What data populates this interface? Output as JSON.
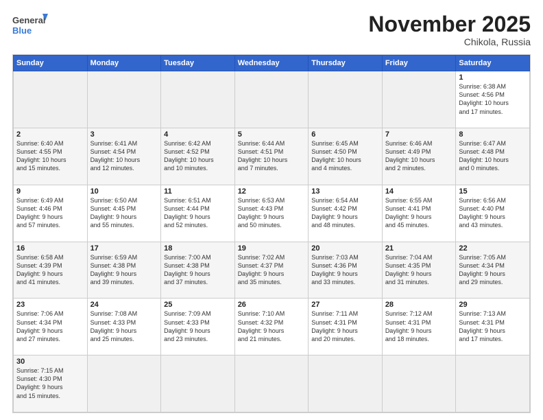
{
  "header": {
    "logo_general": "General",
    "logo_blue": "Blue",
    "month_title": "November 2025",
    "subtitle": "Chikola, Russia"
  },
  "weekdays": [
    "Sunday",
    "Monday",
    "Tuesday",
    "Wednesday",
    "Thursday",
    "Friday",
    "Saturday"
  ],
  "weeks": [
    [
      {
        "day": "",
        "info": "",
        "empty": true
      },
      {
        "day": "",
        "info": "",
        "empty": true
      },
      {
        "day": "",
        "info": "",
        "empty": true
      },
      {
        "day": "",
        "info": "",
        "empty": true
      },
      {
        "day": "",
        "info": "",
        "empty": true
      },
      {
        "day": "",
        "info": "",
        "empty": true
      },
      {
        "day": "1",
        "info": "Sunrise: 6:38 AM\nSunset: 4:56 PM\nDaylight: 10 hours\nand 17 minutes.",
        "empty": false
      }
    ],
    [
      {
        "day": "2",
        "info": "Sunrise: 6:40 AM\nSunset: 4:55 PM\nDaylight: 10 hours\nand 15 minutes.",
        "empty": false
      },
      {
        "day": "3",
        "info": "Sunrise: 6:41 AM\nSunset: 4:54 PM\nDaylight: 10 hours\nand 12 minutes.",
        "empty": false
      },
      {
        "day": "4",
        "info": "Sunrise: 6:42 AM\nSunset: 4:52 PM\nDaylight: 10 hours\nand 10 minutes.",
        "empty": false
      },
      {
        "day": "5",
        "info": "Sunrise: 6:44 AM\nSunset: 4:51 PM\nDaylight: 10 hours\nand 7 minutes.",
        "empty": false
      },
      {
        "day": "6",
        "info": "Sunrise: 6:45 AM\nSunset: 4:50 PM\nDaylight: 10 hours\nand 4 minutes.",
        "empty": false
      },
      {
        "day": "7",
        "info": "Sunrise: 6:46 AM\nSunset: 4:49 PM\nDaylight: 10 hours\nand 2 minutes.",
        "empty": false
      },
      {
        "day": "8",
        "info": "Sunrise: 6:47 AM\nSunset: 4:48 PM\nDaylight: 10 hours\nand 0 minutes.",
        "empty": false
      }
    ],
    [
      {
        "day": "9",
        "info": "Sunrise: 6:49 AM\nSunset: 4:46 PM\nDaylight: 9 hours\nand 57 minutes.",
        "empty": false
      },
      {
        "day": "10",
        "info": "Sunrise: 6:50 AM\nSunset: 4:45 PM\nDaylight: 9 hours\nand 55 minutes.",
        "empty": false
      },
      {
        "day": "11",
        "info": "Sunrise: 6:51 AM\nSunset: 4:44 PM\nDaylight: 9 hours\nand 52 minutes.",
        "empty": false
      },
      {
        "day": "12",
        "info": "Sunrise: 6:53 AM\nSunset: 4:43 PM\nDaylight: 9 hours\nand 50 minutes.",
        "empty": false
      },
      {
        "day": "13",
        "info": "Sunrise: 6:54 AM\nSunset: 4:42 PM\nDaylight: 9 hours\nand 48 minutes.",
        "empty": false
      },
      {
        "day": "14",
        "info": "Sunrise: 6:55 AM\nSunset: 4:41 PM\nDaylight: 9 hours\nand 45 minutes.",
        "empty": false
      },
      {
        "day": "15",
        "info": "Sunrise: 6:56 AM\nSunset: 4:40 PM\nDaylight: 9 hours\nand 43 minutes.",
        "empty": false
      }
    ],
    [
      {
        "day": "16",
        "info": "Sunrise: 6:58 AM\nSunset: 4:39 PM\nDaylight: 9 hours\nand 41 minutes.",
        "empty": false
      },
      {
        "day": "17",
        "info": "Sunrise: 6:59 AM\nSunset: 4:38 PM\nDaylight: 9 hours\nand 39 minutes.",
        "empty": false
      },
      {
        "day": "18",
        "info": "Sunrise: 7:00 AM\nSunset: 4:38 PM\nDaylight: 9 hours\nand 37 minutes.",
        "empty": false
      },
      {
        "day": "19",
        "info": "Sunrise: 7:02 AM\nSunset: 4:37 PM\nDaylight: 9 hours\nand 35 minutes.",
        "empty": false
      },
      {
        "day": "20",
        "info": "Sunrise: 7:03 AM\nSunset: 4:36 PM\nDaylight: 9 hours\nand 33 minutes.",
        "empty": false
      },
      {
        "day": "21",
        "info": "Sunrise: 7:04 AM\nSunset: 4:35 PM\nDaylight: 9 hours\nand 31 minutes.",
        "empty": false
      },
      {
        "day": "22",
        "info": "Sunrise: 7:05 AM\nSunset: 4:34 PM\nDaylight: 9 hours\nand 29 minutes.",
        "empty": false
      }
    ],
    [
      {
        "day": "23",
        "info": "Sunrise: 7:06 AM\nSunset: 4:34 PM\nDaylight: 9 hours\nand 27 minutes.",
        "empty": false
      },
      {
        "day": "24",
        "info": "Sunrise: 7:08 AM\nSunset: 4:33 PM\nDaylight: 9 hours\nand 25 minutes.",
        "empty": false
      },
      {
        "day": "25",
        "info": "Sunrise: 7:09 AM\nSunset: 4:33 PM\nDaylight: 9 hours\nand 23 minutes.",
        "empty": false
      },
      {
        "day": "26",
        "info": "Sunrise: 7:10 AM\nSunset: 4:32 PM\nDaylight: 9 hours\nand 21 minutes.",
        "empty": false
      },
      {
        "day": "27",
        "info": "Sunrise: 7:11 AM\nSunset: 4:31 PM\nDaylight: 9 hours\nand 20 minutes.",
        "empty": false
      },
      {
        "day": "28",
        "info": "Sunrise: 7:12 AM\nSunset: 4:31 PM\nDaylight: 9 hours\nand 18 minutes.",
        "empty": false
      },
      {
        "day": "29",
        "info": "Sunrise: 7:13 AM\nSunset: 4:31 PM\nDaylight: 9 hours\nand 17 minutes.",
        "empty": false
      }
    ],
    [
      {
        "day": "30",
        "info": "Sunrise: 7:15 AM\nSunset: 4:30 PM\nDaylight: 9 hours\nand 15 minutes.",
        "empty": false
      },
      {
        "day": "",
        "info": "",
        "empty": true
      },
      {
        "day": "",
        "info": "",
        "empty": true
      },
      {
        "day": "",
        "info": "",
        "empty": true
      },
      {
        "day": "",
        "info": "",
        "empty": true
      },
      {
        "day": "",
        "info": "",
        "empty": true
      },
      {
        "day": "",
        "info": "",
        "empty": true
      }
    ]
  ]
}
